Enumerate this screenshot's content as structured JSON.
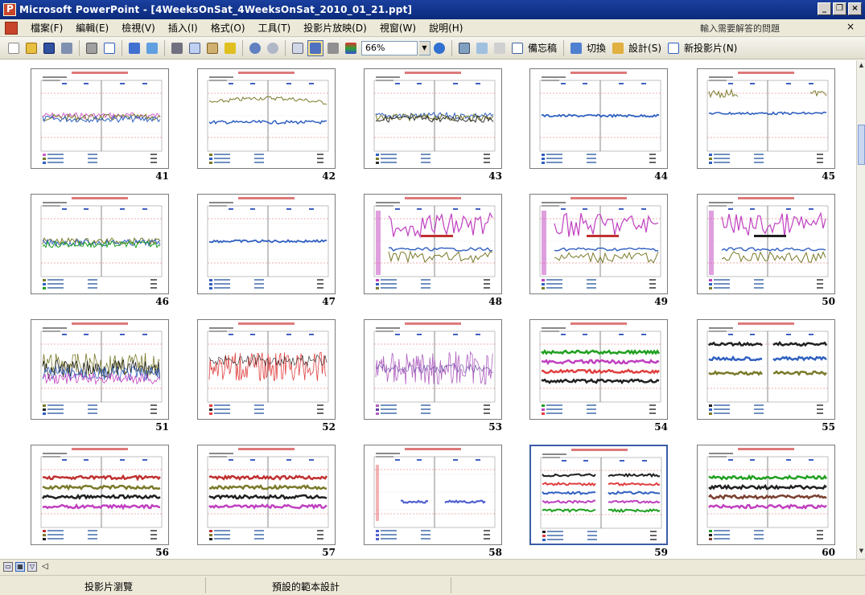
{
  "window": {
    "title": "Microsoft PowerPoint - [4WeeksOnSat_4WeeksOnSat_2010_01_21.ppt]"
  },
  "menu": {
    "items": [
      "檔案(F)",
      "編輯(E)",
      "檢視(V)",
      "插入(I)",
      "格式(O)",
      "工具(T)",
      "投影片放映(D)",
      "視窗(W)",
      "說明(H)"
    ],
    "help_placeholder": "輸入需要解答的問題",
    "close": "×"
  },
  "toolbar": {
    "zoom": "66%",
    "notes_pane": "備忘稿",
    "transition": "切換",
    "design": "設計(S)",
    "new_slide": "新投影片(N)"
  },
  "slides": [
    {
      "number": "41",
      "style": "flat_mix",
      "colors": [
        "#d060c8",
        "#7a7a2a",
        "#3060c0"
      ]
    },
    {
      "number": "42",
      "style": "olive_hump",
      "colors": [
        "#7a7a2a",
        "#3060c0"
      ]
    },
    {
      "number": "43",
      "style": "flat_mix",
      "colors": [
        "#3060c0",
        "#7a7a2a",
        "#303030"
      ]
    },
    {
      "number": "44",
      "style": "single_blue",
      "colors": [
        "#3060c0"
      ]
    },
    {
      "number": "45",
      "style": "olive_top",
      "colors": [
        "#3060c0",
        "#7a7a2a"
      ]
    },
    {
      "number": "46",
      "style": "flat_mix",
      "colors": [
        "#7a7a2a",
        "#3060c0",
        "#20a020"
      ]
    },
    {
      "number": "47",
      "style": "single_blue",
      "colors": [
        "#3060c0"
      ]
    },
    {
      "number": "48",
      "style": "magenta_spikes",
      "colors": [
        "#c040c0",
        "#3060c0",
        "#7a7a2a",
        "#c03030"
      ]
    },
    {
      "number": "49",
      "style": "magenta_spikes",
      "colors": [
        "#c040c0",
        "#3060c0",
        "#7a7a2a",
        "#c03030"
      ]
    },
    {
      "number": "50",
      "style": "magenta_spikes",
      "colors": [
        "#c040c0",
        "#3060c0",
        "#7a7a2a",
        "#202020"
      ]
    },
    {
      "number": "51",
      "style": "noisy_dark",
      "colors": [
        "#7a7a2a",
        "#202020",
        "#3060c0",
        "#c040c0"
      ]
    },
    {
      "number": "52",
      "style": "noisy_red",
      "colors": [
        "#e04040",
        "#202020"
      ]
    },
    {
      "number": "53",
      "style": "noisy_purple",
      "colors": [
        "#b060c0",
        "#6040a0"
      ]
    },
    {
      "number": "54",
      "style": "bands",
      "colors": [
        "#20a020",
        "#c040c0",
        "#e04040",
        "#202020"
      ]
    },
    {
      "number": "55",
      "style": "split_bands",
      "colors": [
        "#202020",
        "#3060c0",
        "#7a7a2a"
      ]
    },
    {
      "number": "56",
      "style": "bands",
      "colors": [
        "#c03030",
        "#7a7a2a",
        "#202020",
        "#c040c0"
      ]
    },
    {
      "number": "57",
      "style": "bands",
      "colors": [
        "#c03030",
        "#7a7a2a",
        "#202020",
        "#c040c0"
      ]
    },
    {
      "number": "58",
      "style": "split_single",
      "colors": [
        "#5060d0"
      ]
    },
    {
      "number": "59",
      "style": "multi_split",
      "colors": [
        "#202020",
        "#e04040",
        "#3060c0",
        "#c040c0",
        "#20a020"
      ],
      "selected": true
    },
    {
      "number": "60",
      "style": "bands",
      "colors": [
        "#20a020",
        "#202020",
        "#7a4030",
        "#c040c0"
      ]
    }
  ],
  "status": {
    "left": "投影片瀏覽",
    "middle": "預設的範本設計"
  }
}
